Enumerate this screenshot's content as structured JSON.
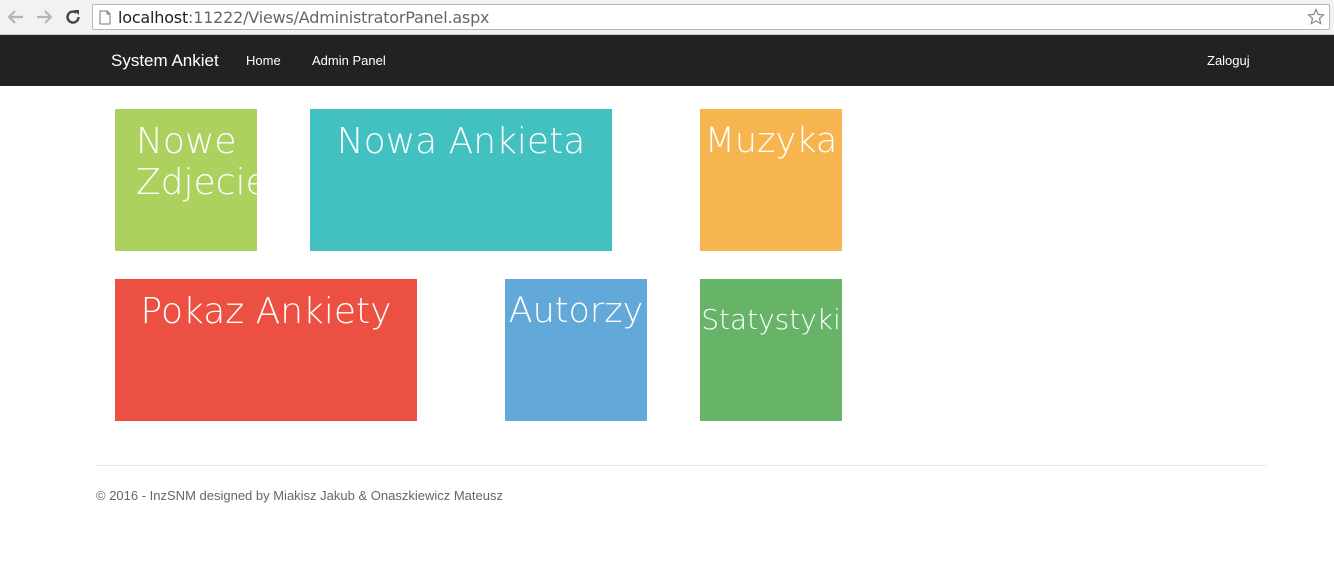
{
  "browser": {
    "url_host": "localhost",
    "url_path": ":11222/Views/AdministratorPanel.aspx"
  },
  "navbar": {
    "brand": "System Ankiet",
    "links": [
      "Home",
      "Admin Panel"
    ],
    "login": "Zaloguj"
  },
  "tiles": [
    {
      "label": "Nowe Zdjecie",
      "color": "#acd15e"
    },
    {
      "label": "Nowa Ankieta",
      "color": "#42c1c0"
    },
    {
      "label": "Muzyka",
      "color": "#f6b54f"
    },
    {
      "label": "Pokaz Ankiety",
      "color": "#ec5043"
    },
    {
      "label": "Autorzy",
      "color": "#62a8d8"
    },
    {
      "label": "Statystyki",
      "color": "#67b367"
    }
  ],
  "footer": {
    "text": "© 2016 - InzSNM designed by Miakisz Jakub & Onaszkiewicz Mateusz"
  }
}
